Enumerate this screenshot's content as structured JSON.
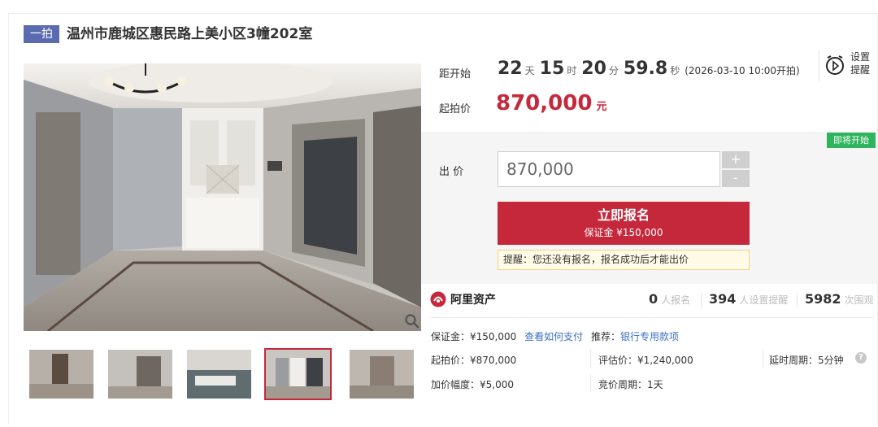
{
  "listing": {
    "tag": "一拍",
    "title": "温州市鹿城区惠民路上美小区3幢202室"
  },
  "countdown": {
    "label": "距开始",
    "days": "22",
    "days_unit": "天",
    "hours": "15",
    "hours_unit": "时",
    "minutes": "20",
    "minutes_unit": "分",
    "seconds": "59.8",
    "seconds_unit": "秒",
    "start_time": "(2026-03-10 10:00开拍)"
  },
  "reminder": {
    "label": "设置提醒",
    "icon": "alarm-clock-icon"
  },
  "starting_price": {
    "label": "起拍价",
    "value": "870,000",
    "unit": "元"
  },
  "bid": {
    "status_badge": "即将开始",
    "label": "出 价",
    "input_value": "870,000",
    "plus": "+",
    "minus": "-",
    "signup_label": "立即报名",
    "deposit_line": "保证金 ¥150,000",
    "tip": "提醒：您还没有报名，报名成功后才能出价"
  },
  "platform": {
    "name": "阿里资产",
    "logo_icon": "ali-assets-logo-icon"
  },
  "stats": [
    {
      "count": "0",
      "text": "人报名"
    },
    {
      "count": "394",
      "text": "人设置提醒"
    },
    {
      "count": "5982",
      "text": "次围观"
    }
  ],
  "details": {
    "deposit_label": "保证金：¥150,000",
    "how_to_pay": "查看如何支付",
    "recommend_label": "推荐：",
    "recommend_link": "银行专用款项",
    "start_price": "起拍价：¥870,000",
    "appraisal": "评估价：¥1,240,000",
    "delay": "延时周期：5分钟",
    "increment": "加价幅度：¥5,000",
    "cycle": "竞价周期：1天"
  },
  "gallery": {
    "selected_index": 3,
    "thumb_count": 5
  },
  "colors": {
    "accent": "#c6283b",
    "tag": "#5b6bb0",
    "badge": "#2db45d",
    "link": "#3a6fc4"
  }
}
